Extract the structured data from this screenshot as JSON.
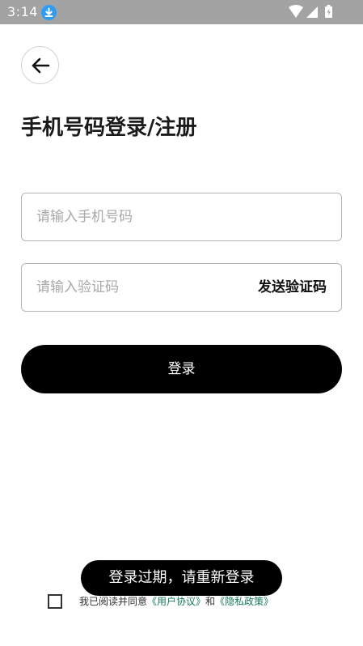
{
  "status_bar": {
    "time": "3:14",
    "icons": [
      "download-icon",
      "wifi-icon",
      "signal-icon",
      "battery-charging-icon"
    ],
    "background": "#a3a3a3"
  },
  "header": {
    "back_icon": "arrow-left-icon",
    "title": "手机号码登录/注册"
  },
  "form": {
    "phone_placeholder": "请输入手机号码",
    "code_placeholder": "请输入验证码",
    "send_code_label": "发送验证码",
    "login_label": "登录"
  },
  "toast": {
    "message": "登录过期，请重新登录"
  },
  "agreement": {
    "checked": false,
    "prefix": "我已阅读并同意",
    "user_agreement": "《用户协议》",
    "and": "和",
    "privacy_policy": "《隐私政策》",
    "link_color": "#177a5a"
  },
  "colors": {
    "primary_button": "#000000",
    "download_badge": "#2f9cf4"
  }
}
